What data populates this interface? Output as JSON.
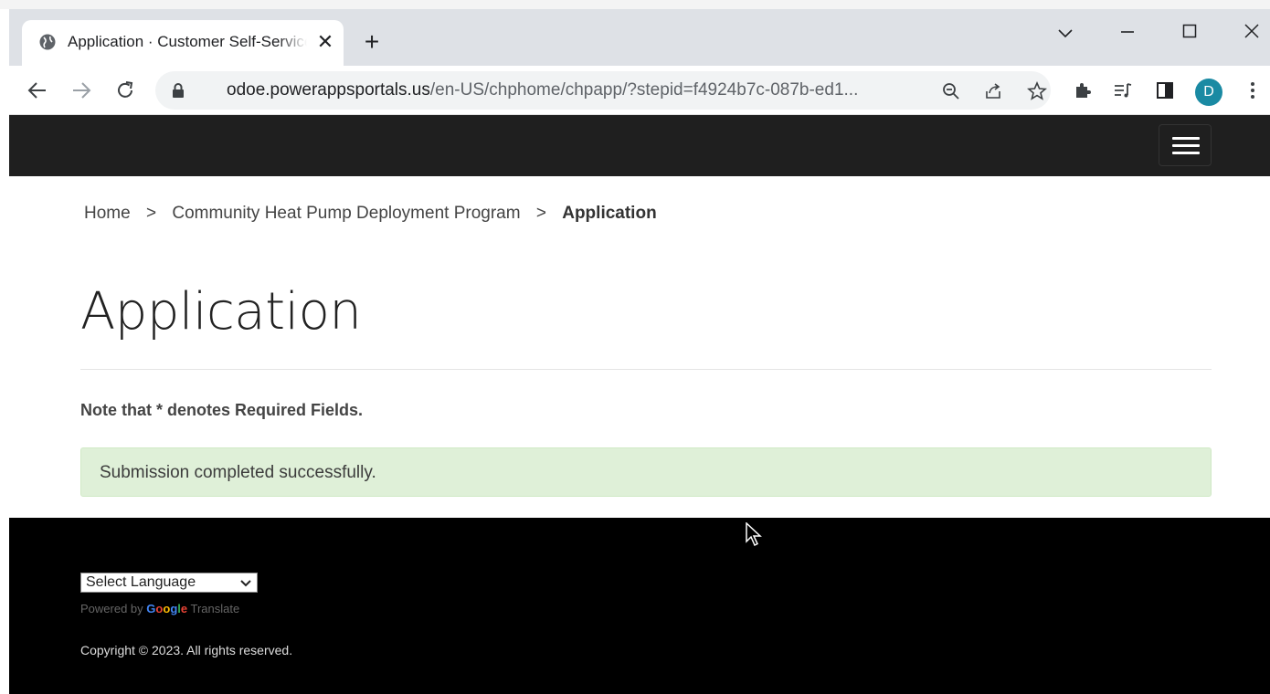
{
  "browser": {
    "tab_title": "Application · Customer Self-Service",
    "tab_close": "✕",
    "new_tab": "+",
    "url_host": "odoe.powerappsportals.us",
    "url_path": "/en-US/chphome/chpapp/?stepid=f4924b7c-087b-ed1...",
    "profile_initial": "D",
    "icons": [
      "globe-icon",
      "close-icon",
      "plus-icon",
      "chevron-down-icon",
      "minimize-icon",
      "maximize-icon",
      "close-window-icon",
      "back-icon",
      "forward-icon",
      "reload-icon",
      "lock-icon",
      "zoom-icon",
      "share-icon",
      "star-icon",
      "extensions-icon",
      "reading-list-icon",
      "side-panel-icon",
      "more-icon"
    ]
  },
  "site": {
    "breadcrumb": {
      "home": "Home",
      "separator": ">",
      "program": "Community Heat Pump Deployment Program",
      "current": "Application"
    },
    "page_title": "Application",
    "required_note": "Note that * denotes Required Fields.",
    "alert_success": "Submission completed successfully.",
    "footer": {
      "language_select": "Select Language",
      "powered_by": "Powered by",
      "google": "Google",
      "translate": "Translate",
      "copyright": "Copyright © 2023. All rights reserved."
    }
  },
  "colors": {
    "header_bg": "#1f1f1f",
    "footer_bg": "#000000",
    "alert_bg": "#dff0d8",
    "avatar_bg": "#1a8aa3"
  }
}
